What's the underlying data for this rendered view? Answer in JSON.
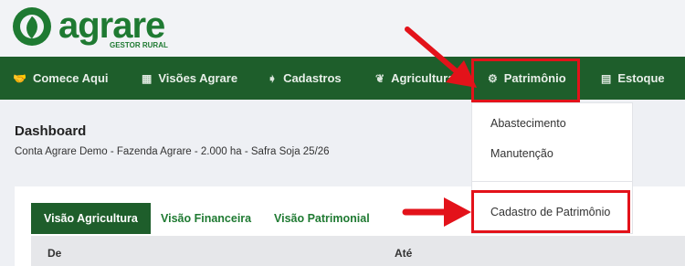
{
  "brand": {
    "name": "agrare",
    "subtitle": "GESTOR RURAL"
  },
  "nav": {
    "items": [
      {
        "label": "Comece Aqui",
        "icon": "handshake-icon",
        "glyph": "🤝"
      },
      {
        "label": "Visões Agrare",
        "icon": "dashboard-icon",
        "glyph": "▦"
      },
      {
        "label": "Cadastros",
        "icon": "signpost-icon",
        "glyph": "➧"
      },
      {
        "label": "Agricultura",
        "icon": "leaf-icon",
        "glyph": "❦"
      },
      {
        "label": "Patrimônio",
        "icon": "tractor-icon",
        "glyph": "⚙"
      },
      {
        "label": "Estoque",
        "icon": "boxes-icon",
        "glyph": "▤"
      }
    ]
  },
  "dashboard": {
    "title": "Dashboard",
    "subtitle": "Conta Agrare Demo - Fazenda Agrare - 2.000 ha - Safra Soja 25/26"
  },
  "tabs": [
    "Visão Agricultura",
    "Visão Financeira",
    "Visão Patrimonial"
  ],
  "table": {
    "headers": [
      "De",
      "Até"
    ]
  },
  "dropdown": {
    "items": [
      "Abastecimento",
      "Manutenção",
      "Cadastro de Patrimônio"
    ]
  },
  "colors": {
    "primary": "#1e5e2b",
    "highlight": "#e3121a"
  }
}
